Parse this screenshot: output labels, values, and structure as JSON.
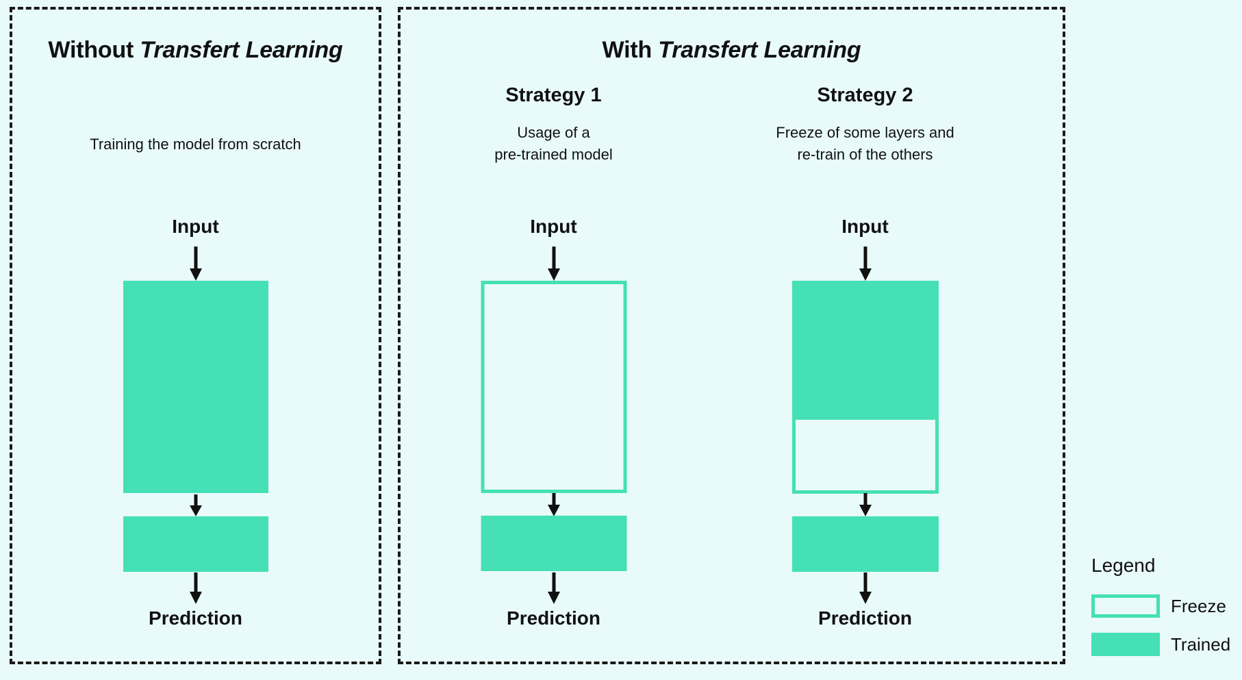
{
  "figure": {
    "background_color": "#e9fafa",
    "accent_color": "#45e0b5",
    "text_color": "#111111",
    "border_color": "#1a1a1a"
  },
  "panels": [
    {
      "id": "without-transfer-learning",
      "title_prefix": "Without ",
      "title_emphasis": "Transfert Learning"
    },
    {
      "id": "with-transfer-learning",
      "title_prefix": "With ",
      "title_emphasis": "Transfert Learning"
    }
  ],
  "columns": [
    {
      "id": "scratch",
      "heading": "",
      "caption": "Training the model from scratch",
      "input_label": "Input",
      "prediction_label": "Prediction",
      "blocks": [
        {
          "name": "backbone",
          "state": "Trained"
        },
        {
          "name": "head",
          "state": "Trained"
        }
      ]
    },
    {
      "id": "strategy-1",
      "heading": "Strategy 1",
      "caption_line_1": "Usage of a",
      "caption_line_2": "pre-trained model",
      "input_label": "Input",
      "prediction_label": "Prediction",
      "blocks": [
        {
          "name": "backbone",
          "state": "Freeze"
        },
        {
          "name": "head",
          "state": "Trained"
        }
      ]
    },
    {
      "id": "strategy-2",
      "heading": "Strategy 2",
      "caption_line_1": "Freeze of some layers and",
      "caption_line_2": "re-train of the others",
      "input_label": "Input",
      "prediction_label": "Prediction",
      "blocks": [
        {
          "name": "backbone-upper",
          "state": "Trained"
        },
        {
          "name": "backbone-lower",
          "state": "Freeze"
        },
        {
          "name": "head",
          "state": "Trained"
        }
      ]
    }
  ],
  "legend": {
    "title": "Legend",
    "items": [
      {
        "label": "Freeze",
        "swatch": "outlined",
        "color": "#45e0b5"
      },
      {
        "label": "Trained",
        "swatch": "filled",
        "color": "#45e0b5"
      }
    ]
  }
}
